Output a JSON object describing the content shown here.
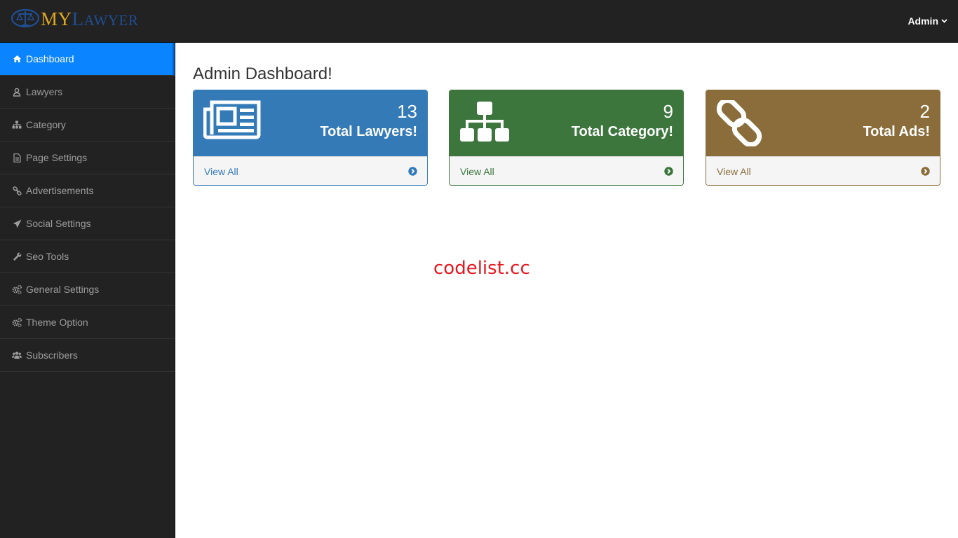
{
  "header": {
    "logo_my": "MY",
    "logo_l": "L",
    "logo_rest": "AWYER",
    "admin_label": "Admin"
  },
  "sidebar": {
    "items": [
      {
        "label": "Dashboard",
        "icon": "home-icon",
        "active": true
      },
      {
        "label": "Lawyers",
        "icon": "user-icon"
      },
      {
        "label": "Category",
        "icon": "sitemap-icon"
      },
      {
        "label": "Page Settings",
        "icon": "file-icon"
      },
      {
        "label": "Advertisements",
        "icon": "link-icon"
      },
      {
        "label": "Social Settings",
        "icon": "paper-plane-icon"
      },
      {
        "label": "Seo Tools",
        "icon": "wrench-icon"
      },
      {
        "label": "General Settings",
        "icon": "gears-icon"
      },
      {
        "label": "Theme Option",
        "icon": "gears-icon"
      },
      {
        "label": "Subscribers",
        "icon": "users-icon"
      }
    ]
  },
  "main": {
    "title": "Admin Dashboard!",
    "panels": [
      {
        "count": "13",
        "label": "Total Lawyers!",
        "link": "View All",
        "icon": "newspaper-icon",
        "color": "#337ab7"
      },
      {
        "count": "9",
        "label": "Total Category!",
        "link": "View All",
        "icon": "sitemap-icon",
        "color": "#3c763d"
      },
      {
        "count": "2",
        "label": "Total Ads!",
        "link": "View All",
        "icon": "chain-link-icon",
        "color": "#8a6d3b"
      }
    ]
  },
  "watermark": "codelist.cc",
  "colors": {
    "topbar": "#222222",
    "sidebar": "#222222",
    "active": "#0a84ff",
    "watermark": "#e8171e"
  }
}
